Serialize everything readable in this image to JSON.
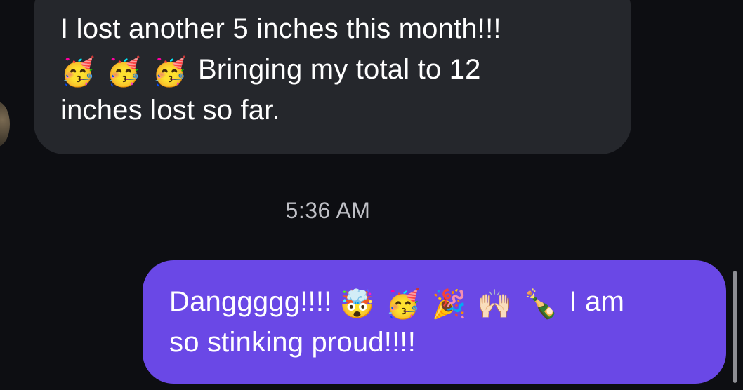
{
  "thread": {
    "incoming": {
      "line1": "I lost another 5 inches this month!!!",
      "line2_emojis": [
        "🥳",
        "🥳",
        "🥳"
      ],
      "line2_text": "Bringing my total to 12",
      "line3": "inches lost so far."
    },
    "timestamp": "5:36 AM",
    "outgoing": {
      "line1_text": "Danggggg!!!!",
      "line1_emojis": [
        "🤯",
        "🥳",
        "🎉",
        "🙌🏻",
        "🍾"
      ],
      "line1_tail": "I am",
      "line2": "so stinking proud!!!!"
    }
  },
  "colors": {
    "background": "#0d0e12",
    "incoming_bubble": "#25272c",
    "outgoing_bubble": "#6a48e6",
    "timestamp": "#bfc0c6"
  }
}
